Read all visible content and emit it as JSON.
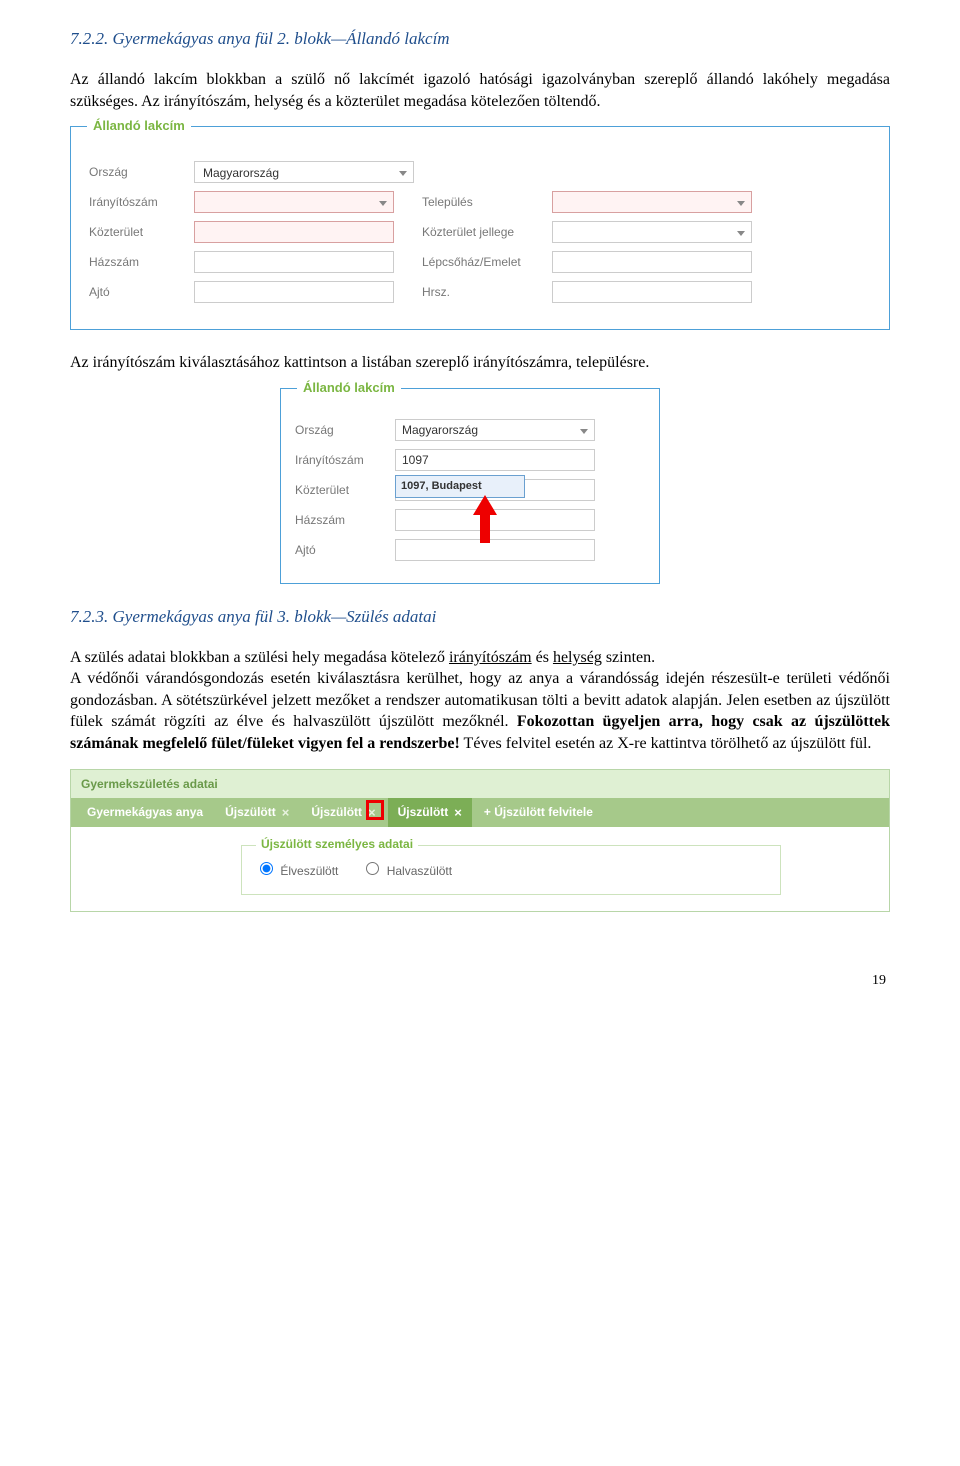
{
  "section1": {
    "heading": "7.2.2. Gyermekágyas anya fül 2. blokk—Állandó lakcím",
    "para": "Az állandó lakcím blokkban a szülő nő lakcímét igazoló hatósági igazolványban szereplő állandó lakóhely megadása szükséges. Az irányítószám, helység és a közterület megadása kötelezően töltendő."
  },
  "form1": {
    "legend": "Állandó lakcím",
    "labels": {
      "country": "Ország",
      "zip": "Irányítószám",
      "city": "Település",
      "street": "Közterület",
      "streetType": "Közterület jellege",
      "houseNo": "Házszám",
      "floor": "Lépcsőház/Emelet",
      "door": "Ajtó",
      "hrsz": "Hrsz."
    },
    "values": {
      "country": "Magyarország"
    }
  },
  "midPara": "Az irányítószám kiválasztásához kattintson a listában szereplő irányítószámra, településre.",
  "form2": {
    "legend": "Állandó lakcím",
    "labels": {
      "country": "Ország",
      "zip": "Irányítószám",
      "street": "Közterület",
      "houseNo": "Házszám",
      "door": "Ajtó"
    },
    "values": {
      "country": "Magyarország",
      "zip": "1097"
    },
    "suggestion": "1097, Budapest"
  },
  "section2": {
    "heading": "7.2.3. Gyermekágyas anya fül 3. blokk—Szülés adatai",
    "para1a": "A szülés adatai blokkban a szülési hely megadása kötelező ",
    "para1_u1": "irányítószám",
    "para1b": " és ",
    "para1_u2": "helység",
    "para1c": " szinten.",
    "para2": "A védőnői várandósgondozás esetén kiválasztásra kerülhet, hogy az anya a várandósság idején részesült-e területi védőnői gondozásban. A sötétszürkével jelzett mezőket a rendszer automatikusan tölti a bevitt adatok alapján. Jelen esetben az újszülött fülek számát rögzíti az élve és halvaszülött újszülött mezőknél. ",
    "para2_bold": "Fokozottan ügyeljen arra, hogy csak az újszülöttek számának megfelelő fület/füleket vigyen fel a rendszerbe!",
    "para2_tail": " Téves felvitel esetén az X-re kattintva törölhető az újszülött fül."
  },
  "tabs": {
    "panelTitle": "Gyermekszületés adatai",
    "t1": "Gyermekágyas anya",
    "t2": "Újszülött",
    "t3": "Újszülött",
    "t4": "Újszülött",
    "addTab": "+ Újszülött felvitele",
    "innerLegend": "Újszülött személyes adatai",
    "radio1": "Élveszülött",
    "radio2": "Halvaszülött"
  },
  "pageNumber": "19"
}
